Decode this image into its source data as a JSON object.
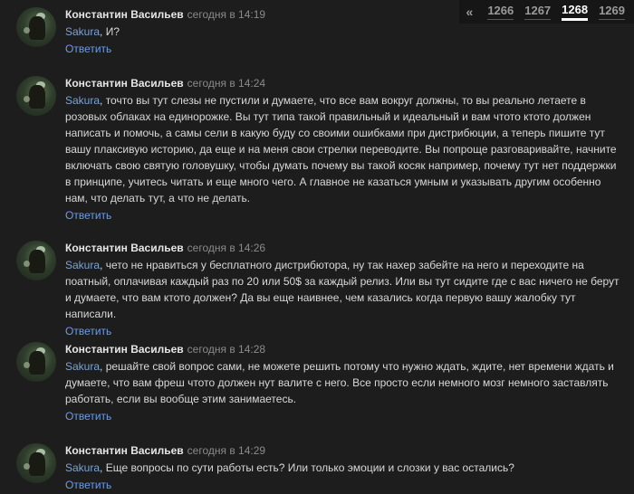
{
  "pager": {
    "prev": "«",
    "pages": [
      "1266",
      "1267",
      "1268",
      "1269"
    ],
    "active": "1268"
  },
  "comments": [
    {
      "author": "Константин Васильев",
      "time": "сегодня в 14:19",
      "mention": "Sakura",
      "text": ", И?",
      "reply": "Ответить"
    },
    {
      "author": "Константин Васильев",
      "time": "сегодня в 14:24",
      "mention": "Sakura",
      "text": ", точто вы тут слезы не пустили и думаете, что все вам вокруг должны, то вы реально летаете в розовых облаках на единорожке. Вы тут типа такой правильный и идеальный и вам чтото ктото должен написать и помочь, а самы сели в какую буду со своими ошибками при дистрибюции, а теперь пишите тут вашу плаксивую историю, да еще и на меня свои стрелки переводите. Вы попроще разговаривайте, начните включать свою святую головушку, чтобы думать почему вы такой косяк например, почему тут нет поддержки в принципе, учитесь читать и еще много чего. А главное не казаться умным и указывать другим особенно нам, что делать тут, а что не делать.",
      "reply": "Ответить"
    },
    {
      "author": "Константин Васильев",
      "time": "сегодня в 14:26",
      "mention": "Sakura",
      "text": ", чето не нравиться у бесплатного дистрибютора, ну так нахер забейте на него и переходите на поатный, оплачивая каждый раз по 20 или 50$ за каждый релиз. Или вы тут сидите где с вас ничего не берут и думаете, что вам ктото должен? Да вы еще наивнее, чем казались когда первую вашу жалобку тут написали.",
      "reply": "Ответить"
    },
    {
      "author": "Константин Васильев",
      "time": "сегодня в 14:28",
      "mention": "Sakura",
      "text": ", решайте свой вопрос сами, не можете решить потому что нужно ждать, ждите, нет времени ждать и думаете, что вам фреш чтото должен нут валите с него. Все просто если немного мозг немного заставлять работать, если вы вообще этим занимаетесь.",
      "reply": "Ответить"
    },
    {
      "author": "Константин Васильев",
      "time": "сегодня в 14:29",
      "mention": "Sakura",
      "text": ", Еще вопросы по сути работы есть? Или только эмоции и слозки у вас остались?",
      "reply": "Ответить"
    }
  ]
}
